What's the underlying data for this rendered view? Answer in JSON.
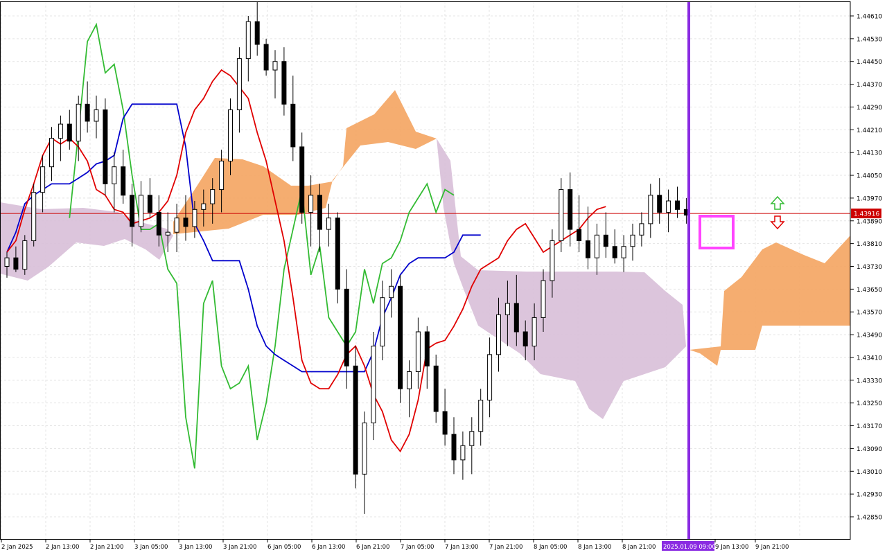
{
  "chart_data": {
    "type": "candlestick",
    "symbol_timeframe": "H1",
    "ylim": [
      1.428,
      1.4465
    ],
    "price_levels": [
      "1.44610",
      "1.44530",
      "1.44450",
      "1.44370",
      "1.44290",
      "1.44210",
      "1.44130",
      "1.44050",
      "1.43970",
      "1.43890",
      "1.43810",
      "1.43730",
      "1.43650",
      "1.43570",
      "1.43490",
      "1.43410",
      "1.43330",
      "1.43250",
      "1.43170",
      "1.43090",
      "1.43010",
      "1.42930",
      "1.42850"
    ],
    "time_labels": [
      "2 Jan 2025",
      "2 Jan 13:00",
      "2 Jan 21:00",
      "3 Jan 05:00",
      "3 Jan 13:00",
      "3 Jan 21:00",
      "6 Jan 05:00",
      "6 Jan 13:00",
      "6 Jan 21:00",
      "7 Jan 05:00",
      "7 Jan 13:00",
      "7 Jan 21:00",
      "8 Jan 05:00",
      "8 Jan 13:00",
      "8 Jan 21:00",
      "2025.01.09 09:00",
      "9 Jan 13:00",
      "9 Jan 21:00"
    ],
    "current_price": "1.43916",
    "marker_time": "2025.01.09 09:00",
    "grid": true,
    "colors": {
      "tenkan": "#e00000",
      "kijun": "#0000cc",
      "chikou": "#33bb33",
      "kumo_bull": "#f4a460",
      "kumo_bear": "#d8bfd8",
      "marker": "#8a2be2",
      "highlight": "#ff44ff",
      "price_line": "#cc0000"
    },
    "candles": [
      [
        1.4373,
        1.4378,
        1.4369,
        1.4376
      ],
      [
        1.4376,
        1.438,
        1.4371,
        1.4372
      ],
      [
        1.4372,
        1.4384,
        1.437,
        1.4382
      ],
      [
        1.4382,
        1.4402,
        1.438,
        1.4399
      ],
      [
        1.4399,
        1.4412,
        1.4392,
        1.4408
      ],
      [
        1.4408,
        1.4422,
        1.4403,
        1.4418
      ],
      [
        1.4418,
        1.4426,
        1.441,
        1.4423
      ],
      [
        1.4423,
        1.4428,
        1.4414,
        1.4417
      ],
      [
        1.4417,
        1.4433,
        1.441,
        1.443
      ],
      [
        1.443,
        1.4438,
        1.442,
        1.4424
      ],
      [
        1.4424,
        1.4433,
        1.4418,
        1.4428
      ],
      [
        1.4428,
        1.4432,
        1.4398,
        1.4402
      ],
      [
        1.4402,
        1.4413,
        1.4392,
        1.4408
      ],
      [
        1.4408,
        1.4414,
        1.4395,
        1.4398
      ],
      [
        1.4398,
        1.4402,
        1.438,
        1.4387
      ],
      [
        1.4387,
        1.4403,
        1.4385,
        1.4398
      ],
      [
        1.4398,
        1.4404,
        1.439,
        1.4392
      ],
      [
        1.4392,
        1.4398,
        1.438,
        1.4384
      ],
      [
        1.4384,
        1.4392,
        1.4378,
        1.4385
      ],
      [
        1.4385,
        1.4395,
        1.4378,
        1.439
      ],
      [
        1.439,
        1.4398,
        1.4382,
        1.4387
      ],
      [
        1.4387,
        1.4396,
        1.4383,
        1.4393
      ],
      [
        1.4393,
        1.44,
        1.4387,
        1.4395
      ],
      [
        1.4395,
        1.4404,
        1.4388,
        1.44
      ],
      [
        1.44,
        1.4414,
        1.4392,
        1.441
      ],
      [
        1.441,
        1.4432,
        1.4405,
        1.4428
      ],
      [
        1.4428,
        1.445,
        1.442,
        1.4446
      ],
      [
        1.4446,
        1.4461,
        1.4438,
        1.4459
      ],
      [
        1.4459,
        1.4466,
        1.4447,
        1.4451
      ],
      [
        1.4451,
        1.4453,
        1.444,
        1.4442
      ],
      [
        1.4442,
        1.4449,
        1.4432,
        1.4445
      ],
      [
        1.4445,
        1.445,
        1.4426,
        1.443
      ],
      [
        1.443,
        1.444,
        1.441,
        1.4415
      ],
      [
        1.4415,
        1.442,
        1.4388,
        1.4392
      ],
      [
        1.4392,
        1.4405,
        1.438,
        1.4398
      ],
      [
        1.4398,
        1.4402,
        1.4378,
        1.4386
      ],
      [
        1.4386,
        1.4395,
        1.438,
        1.439
      ],
      [
        1.439,
        1.4392,
        1.436,
        1.4365
      ],
      [
        1.4365,
        1.4372,
        1.433,
        1.4338
      ],
      [
        1.4338,
        1.4345,
        1.4295,
        1.43
      ],
      [
        1.43,
        1.4322,
        1.4286,
        1.4318
      ],
      [
        1.4318,
        1.435,
        1.4312,
        1.4345
      ],
      [
        1.4345,
        1.4368,
        1.434,
        1.4362
      ],
      [
        1.4362,
        1.4372,
        1.4355,
        1.4366
      ],
      [
        1.4366,
        1.437,
        1.4325,
        1.433
      ],
      [
        1.433,
        1.434,
        1.432,
        1.4336
      ],
      [
        1.4336,
        1.4355,
        1.433,
        1.435
      ],
      [
        1.435,
        1.4352,
        1.433,
        1.4338
      ],
      [
        1.4338,
        1.4342,
        1.4318,
        1.4322
      ],
      [
        1.4322,
        1.433,
        1.431,
        1.4314
      ],
      [
        1.4314,
        1.432,
        1.43,
        1.4305
      ],
      [
        1.4305,
        1.4315,
        1.4298,
        1.431
      ],
      [
        1.431,
        1.432,
        1.43,
        1.4315
      ],
      [
        1.4315,
        1.433,
        1.431,
        1.4326
      ],
      [
        1.4326,
        1.4348,
        1.432,
        1.4342
      ],
      [
        1.4342,
        1.4362,
        1.4336,
        1.4356
      ],
      [
        1.4356,
        1.4368,
        1.4345,
        1.436
      ],
      [
        1.436,
        1.437,
        1.4345,
        1.435
      ],
      [
        1.435,
        1.4354,
        1.434,
        1.4345
      ],
      [
        1.4345,
        1.436,
        1.434,
        1.4355
      ],
      [
        1.4355,
        1.4372,
        1.435,
        1.4368
      ],
      [
        1.4368,
        1.4386,
        1.4362,
        1.4382
      ],
      [
        1.4382,
        1.4404,
        1.4378,
        1.44
      ],
      [
        1.44,
        1.4406,
        1.438,
        1.4386
      ],
      [
        1.4386,
        1.4398,
        1.4378,
        1.4382
      ],
      [
        1.4382,
        1.4394,
        1.4372,
        1.4376
      ],
      [
        1.4376,
        1.4388,
        1.437,
        1.4384
      ],
      [
        1.4384,
        1.4392,
        1.4376,
        1.438
      ],
      [
        1.438,
        1.4386,
        1.4374,
        1.4376
      ],
      [
        1.4376,
        1.4384,
        1.4371,
        1.438
      ],
      [
        1.438,
        1.4388,
        1.4375,
        1.4384
      ],
      [
        1.4384,
        1.4392,
        1.438,
        1.4388
      ],
      [
        1.4388,
        1.4402,
        1.4383,
        1.4398
      ],
      [
        1.4398,
        1.4404,
        1.4388,
        1.4392
      ],
      [
        1.4392,
        1.44,
        1.4385,
        1.4396
      ],
      [
        1.4396,
        1.4401,
        1.439,
        1.4393
      ],
      [
        1.4393,
        1.4397,
        1.4388,
        1.4391
      ]
    ],
    "tenkan_sen": [
      1.4378,
      1.4382,
      1.4393,
      1.4402,
      1.4412,
      1.4418,
      1.4416,
      1.4418,
      1.4415,
      1.441,
      1.44,
      1.4398,
      1.4393,
      1.4392,
      1.4388,
      1.4389,
      1.439,
      1.4392,
      1.4396,
      1.4405,
      1.442,
      1.4428,
      1.4432,
      1.4438,
      1.4442,
      1.444,
      1.4436,
      1.4432,
      1.442,
      1.441,
      1.4396,
      1.4382,
      1.4362,
      1.434,
      1.4332,
      1.433,
      1.433,
      1.4335,
      1.4342,
      1.4345,
      1.4338,
      1.4328,
      1.4322,
      1.4312,
      1.4308,
      1.4314,
      1.4326,
      1.4344,
      1.4346,
      1.4347,
      1.4352,
      1.4358,
      1.4366,
      1.4372,
      1.4374,
      1.4376,
      1.4382,
      1.4386,
      1.4388,
      1.4383,
      1.4378,
      1.438,
      1.4382,
      1.4384,
      1.4386,
      1.439,
      1.4393,
      1.4394
    ],
    "kijun_sen": [
      1.4378,
      1.4385,
      1.4395,
      1.4398,
      1.44,
      1.4402,
      1.4402,
      1.4402,
      1.4404,
      1.4406,
      1.4409,
      1.441,
      1.4412,
      1.4425,
      1.443,
      1.443,
      1.443,
      1.443,
      1.443,
      1.443,
      1.4415,
      1.4388,
      1.4382,
      1.4375,
      1.4375,
      1.4375,
      1.4375,
      1.4365,
      1.4352,
      1.4345,
      1.4342,
      1.434,
      1.4338,
      1.4336,
      1.4336,
      1.4336,
      1.4336,
      1.4336,
      1.4336,
      1.4336,
      1.4336,
      1.4343,
      1.4355,
      1.4362,
      1.437,
      1.4374,
      1.4376,
      1.4376,
      1.4376,
      1.4376,
      1.4378,
      1.4384,
      1.4384,
      1.4384
    ],
    "chikou_span": [
      1.439,
      1.442,
      1.4452,
      1.4458,
      1.4441,
      1.4444,
      1.4428,
      1.4405,
      1.4386,
      1.4386,
      1.4388,
      1.4372,
      1.4367,
      1.432,
      1.4302,
      1.436,
      1.4368,
      1.4338,
      1.433,
      1.4332,
      1.4338,
      1.4312,
      1.4325,
      1.4345,
      1.4372,
      1.4386,
      1.44,
      1.437,
      1.438,
      1.4355,
      1.435,
      1.4345,
      1.435,
      1.4372,
      1.436,
      1.4374,
      1.4376,
      1.4382,
      1.4392,
      1.4397,
      1.4402,
      1.4392,
      1.44,
      1.4398
    ]
  }
}
